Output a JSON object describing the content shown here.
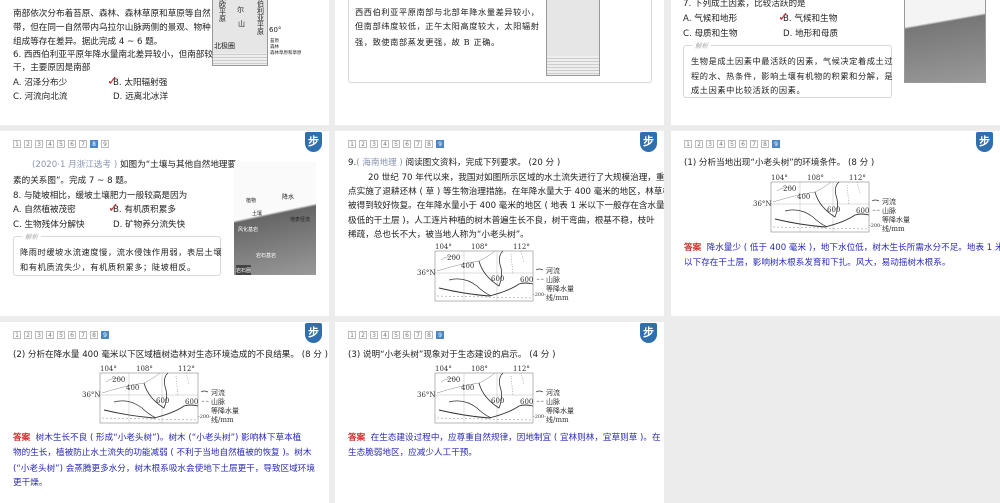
{
  "nav_pages": [
    "1",
    "2",
    "3",
    "4",
    "5",
    "6",
    "7",
    "8",
    "9"
  ],
  "logo_glyph": "步",
  "accent_color": "#4a86c8",
  "analysis_label": "解析",
  "answer_label": "答案",
  "slide_a": {
    "lines": [
      "南部依次分布着苔原、森林、森林草原和草原等自然",
      "带，但在同一自然带内乌拉尔山脉两侧的景观、物种",
      "组成等存在差异。据此完成 4 ~ 6 题。",
      "6. 西西伯利亚平原年降水量南北差异较小，但南部较",
      "干，主要原因是南部"
    ],
    "options": [
      "A. 沼泽分布少",
      "B. 太阳辐射强",
      "C. 河流向北流",
      "D. 远离北冰洋"
    ],
    "map_labels": {
      "arctic": "北极圈",
      "east": "东欧平原",
      "ural1": "乌",
      "ural2": "拉",
      "ural3": "尔",
      "ural4": "山",
      "west": "西西伯利亚平原",
      "lat": "60°"
    },
    "legend": [
      "苔原",
      "森林",
      "森林草原和草原"
    ]
  },
  "slide_b": {
    "lines": [
      "西西伯利亚平原南部与北部年降水量差异较小，",
      "但南部纬度较低，正午太阳高度较大，太阳辐射",
      "强，致使南部蒸发更强，故 B 正确。"
    ]
  },
  "slide_c": {
    "question": "7. 下列成土因素，比较活跃的是",
    "options": [
      "A. 气候和地形",
      "B. 气候和生物",
      "C. 母质和生物",
      "D. 地形和母质"
    ],
    "analysis": [
      "生物是成土因素中最活跃的因素，气候决定着成土过",
      "程的水、热条件，影响土壤有机物的积累和分解，是",
      "成土因素中比较活跃的因素。"
    ]
  },
  "slide_d": {
    "active_page": "8",
    "source": "(2020·1 月浙江选考 )",
    "intro_1": " 如图为“土壤与其他自然地理要",
    "intro_2": "素的关系图”。完成 7 ~ 8 题。",
    "question": "8. 与陡坡相比，缓坡土壤肥力一般较高是因为",
    "options": [
      "A. 自然植被茂密",
      "B. 有机质积累多",
      "C. 生物残体分解快",
      "D. 矿物养分流失快"
    ],
    "analysis": [
      "降雨时缓坡水流速度慢，流水侵蚀作用弱，表层土壤",
      "和有机质流失少，有机质积累多；陡坡相反。"
    ],
    "diagram_labels": {
      "rain": "降水",
      "plant": "植物",
      "soil": "土壤",
      "slope": "地表径流",
      "weathered": "风化基岩",
      "bedrock": "岩石基岩",
      "corner": "岩石圈"
    }
  },
  "slide_e": {
    "active_page": "9",
    "q_num": "9.",
    "source": "( 海南地理 )",
    "q_text": " 阅读图文资料，完成下列要求。 (20 分 )",
    "paragraph": [
      "20 世纪 70 年代以来，我国对如图所示区域的水土流失进行了大规模治理，重",
      "点实施了退耕还林 ( 草 ) 等生物治理措施。在年降水量大于 400 毫米的地区，林草植",
      "被得到较好恢复。在年降水量小于 400 毫米的地区 ( 地表 1 米以下一般存在含水量",
      "极低的干土层 )，人工连片种植的树木普遍生长不良，树干弯曲，根基不稳，枝叶",
      "稀疏，总也长不大，被当地人称为“小老头树”。"
    ]
  },
  "slide_f": {
    "active_page": "9",
    "question": "(1) 分析当地出现“小老头树”的环境条件。 (8 分 )",
    "answer": [
      "降水量少 ( 低于 400 毫米 )，地下水位低，树木生长所需水分不足。地表 1 米",
      "以下存在干土层，影响树木根系发育和下扎。风大，易动摇树木根系。"
    ]
  },
  "slide_g": {
    "active_page": "9",
    "question": "(2) 分析在降水量 400 毫米以下区域植树造林对生态环境造成的不良结果。 (8 分 )",
    "answer": [
      "树木生长不良 ( 形成“小老头树”)。树木 (“小老头树”) 影响林下草本植",
      "物的生长，植被防止水土流失的功能减弱 ( 不利于当地自然植被的恢复 )。树木",
      "(“小老头树”) 会蒸腾更多水分，树木根系吸水会使地下土层更干，导致区域环境",
      "更干燥。"
    ]
  },
  "slide_h": {
    "active_page": "9",
    "question": "(3) 说明“小老头树”现象对于生态建设的启示。 (4 分 )",
    "answer": [
      "在生态建设过程中，应尊重自然规律，因地制宜 ( 宜林则林，宜草则草 )。在",
      "生态脆弱地区，应减少人工干预。"
    ]
  },
  "precip_map": {
    "lon": [
      "104°",
      "108°",
      "112°"
    ],
    "lat": "36°N",
    "iso": [
      "200",
      "400",
      "600",
      "600"
    ],
    "legend": [
      "河流",
      "山脉",
      "等降水量",
      "线/mm"
    ],
    "legend_iso": "-200-"
  }
}
